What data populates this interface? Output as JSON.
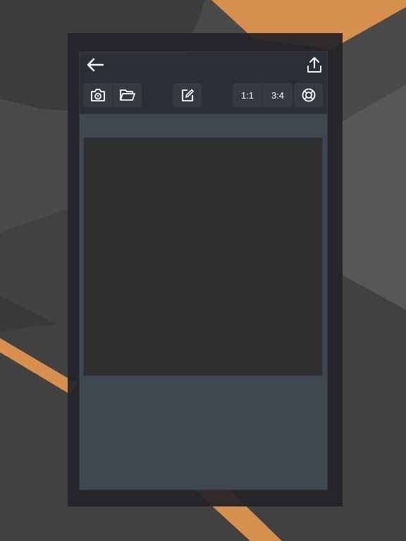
{
  "toolbar": {
    "back_icon": "arrow-left-icon",
    "share_icon": "share-upload-icon",
    "file_group": {
      "camera_icon": "camera-icon",
      "open_icon": "folder-open-icon"
    },
    "edit_icon": "edit-pencil-icon",
    "ratio_options": [
      "1:1",
      "3:4"
    ],
    "help_icon": "lifebuoy-icon"
  },
  "colors": {
    "accent": "#d68f4c",
    "background": "#4a4a4a",
    "toolbar": "#2c2f37",
    "panel": "#3f4751",
    "canvas": "#2d2f31",
    "icon": "#ffffff"
  }
}
